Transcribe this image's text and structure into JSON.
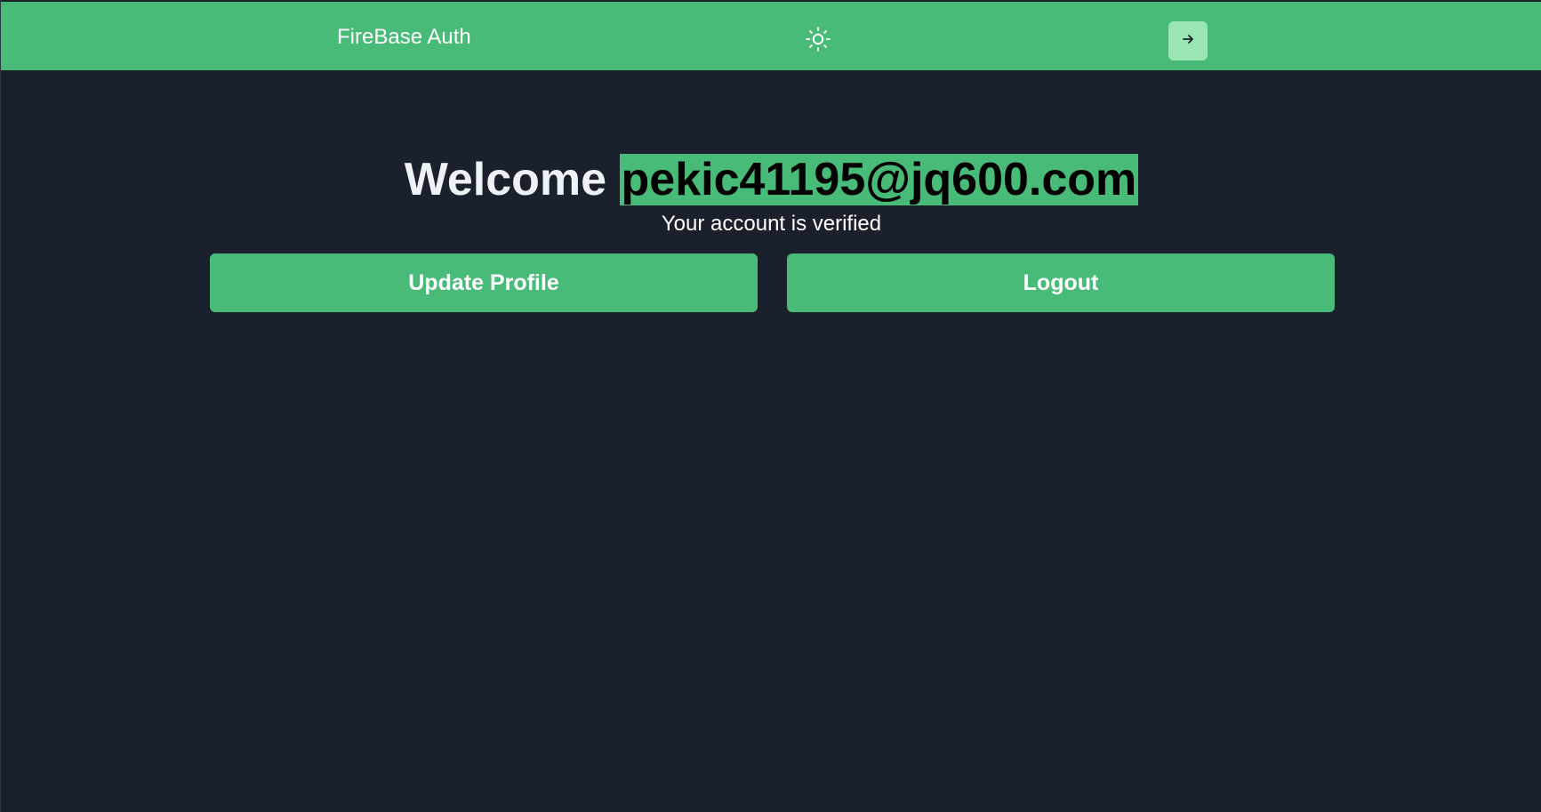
{
  "navbar": {
    "brand": "FireBase Auth",
    "theme_icon": "sun-icon",
    "action_icon": "arrow-right-icon",
    "background_color": "#48bb78"
  },
  "main": {
    "welcome_label": "Welcome",
    "email": "pekic41195@jq600.com",
    "status_text": "Your account is verified",
    "buttons": {
      "update_profile": "Update Profile",
      "logout": "Logout"
    }
  },
  "colors": {
    "accent": "#48bb78",
    "background": "#1a202c",
    "action_button": "#9ae6b4"
  }
}
